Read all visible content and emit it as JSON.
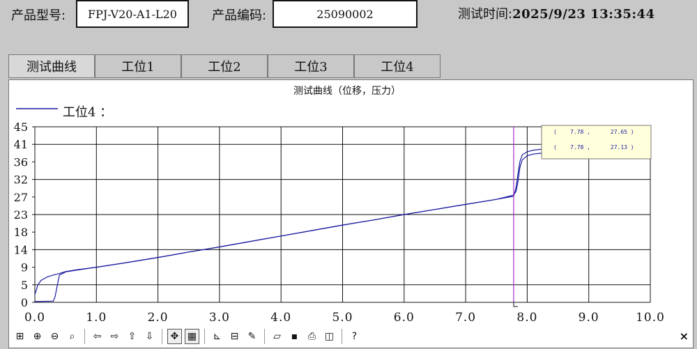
{
  "header": {
    "model_label": "产品型号:",
    "model_value": "FPJ-V20-A1-L20",
    "code_label": "产品编码:",
    "code_value": "25090002",
    "time_label": "测试时间:",
    "time_value": "2025/9/23  13:35:44"
  },
  "tabs": [
    {
      "label": "测试曲线"
    },
    {
      "label": "工位1"
    },
    {
      "label": "工位2"
    },
    {
      "label": "工位3"
    },
    {
      "label": "工位4"
    }
  ],
  "toolbar": {
    "icons": [
      "zoom-box-icon",
      "zoom-in-icon",
      "zoom-out-icon",
      "zoom-reset-icon",
      "pan-left-icon",
      "pan-right-icon",
      "pan-up-icon",
      "pan-down-icon",
      "cursor-mode-icon",
      "grid-toggle-icon",
      "axis-settings-icon",
      "data-view-icon",
      "properties-icon",
      "open-icon",
      "save-icon",
      "print-icon",
      "print-preview-icon",
      "help-icon"
    ],
    "close": "×"
  },
  "colors": {
    "line": "#1a1aa0",
    "cursor": "#a030c0",
    "tooltip_bg": "#ffffdc"
  },
  "chart_data": {
    "type": "line",
    "title": "测试曲线（位移，压力）",
    "legend": "工位4 ：",
    "xlim": [
      0,
      10
    ],
    "ylim": [
      0,
      45
    ],
    "xticks": [
      "0.0",
      "1.0",
      "2.0",
      "3.0",
      "4.0",
      "5.0",
      "6.0",
      "7.0",
      "8.0",
      "9.0",
      "10.0"
    ],
    "yticks": [
      "0",
      "5",
      "9",
      "14",
      "18",
      "23",
      "27",
      "32",
      "36",
      "41",
      "45"
    ],
    "grid": true,
    "cursor_x": 7.78,
    "tooltip": [
      "(    7.78 ,      27.65 )",
      "(    7.78 ,      27.13 )"
    ],
    "series": [
      {
        "x": [
          0.0,
          0.3,
          0.33,
          0.36,
          0.4,
          0.5,
          0.7,
          1.0,
          1.5,
          2.0,
          2.5,
          3.0,
          3.5,
          4.0,
          4.5,
          5.0,
          5.5,
          6.0,
          6.5,
          7.0,
          7.5,
          7.78,
          7.82,
          7.85,
          7.88,
          7.92,
          8.0,
          8.1,
          8.2,
          8.3,
          8.5,
          9.0,
          9.5,
          10.0
        ],
        "y": [
          0.2,
          0.3,
          1.5,
          4.0,
          7.0,
          7.8,
          8.3,
          9.0,
          10.2,
          11.5,
          12.9,
          14.2,
          15.6,
          17.0,
          18.4,
          19.8,
          21.1,
          22.5,
          23.8,
          25.1,
          26.4,
          27.5,
          28.5,
          31.0,
          34.5,
          36.5,
          37.6,
          38.0,
          38.2,
          38.3,
          38.3,
          38.4,
          38.4,
          38.4
        ]
      },
      {
        "x": [
          0.0,
          0.05,
          0.1,
          0.2,
          0.3,
          0.38,
          0.5,
          0.7,
          1.0,
          1.5,
          2.0,
          2.5,
          3.0,
          3.5,
          4.0,
          4.5,
          5.0,
          5.5,
          6.0,
          6.5,
          7.0,
          7.5,
          7.78,
          7.82,
          7.85,
          7.88,
          7.92,
          8.0,
          8.1,
          8.2,
          8.3,
          8.5,
          9.0,
          9.5,
          10.0
        ],
        "y": [
          2.0,
          4.5,
          5.6,
          6.5,
          7.0,
          7.3,
          7.9,
          8.4,
          9.0,
          10.2,
          11.5,
          12.9,
          14.2,
          15.6,
          17.0,
          18.4,
          19.8,
          21.1,
          22.5,
          23.8,
          25.1,
          26.4,
          27.2,
          29.5,
          33.0,
          36.0,
          37.8,
          38.6,
          39.0,
          39.2,
          39.3,
          39.3,
          39.4,
          39.4,
          39.4
        ]
      }
    ]
  }
}
